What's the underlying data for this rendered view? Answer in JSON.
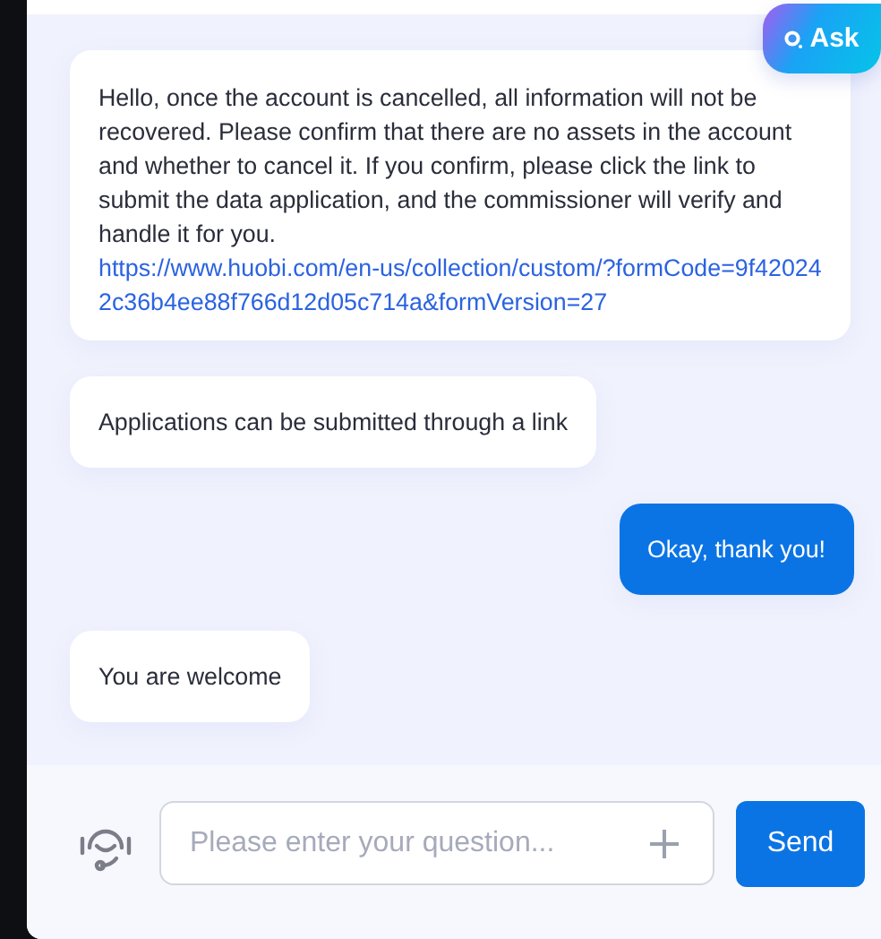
{
  "ask_badge": {
    "label": "Ask"
  },
  "messages": [
    {
      "kind": "agent",
      "parts": [
        {
          "kind": "text",
          "text": "Hello, once the account is cancelled, all information will not be recovered. Please confirm that there are no assets in the account and whether to cancel it. If you confirm, please click the link to submit the data application, and the commissioner will verify and handle it for you. "
        },
        {
          "kind": "link",
          "text": "https://www.huobi.com/en-us/collection/custom/?formCode=9f420242c36b4ee88f766d12d05c714a&formVersion=27"
        }
      ]
    },
    {
      "kind": "agent",
      "parts": [
        {
          "kind": "text",
          "text": "Applications can be submitted through a link"
        }
      ]
    },
    {
      "kind": "user",
      "parts": [
        {
          "kind": "text",
          "text": "Okay, thank you!"
        }
      ]
    },
    {
      "kind": "agent",
      "parts": [
        {
          "kind": "text",
          "text": "You are welcome"
        }
      ]
    }
  ],
  "composer": {
    "placeholder": "Please enter your question...",
    "send": "Send"
  }
}
